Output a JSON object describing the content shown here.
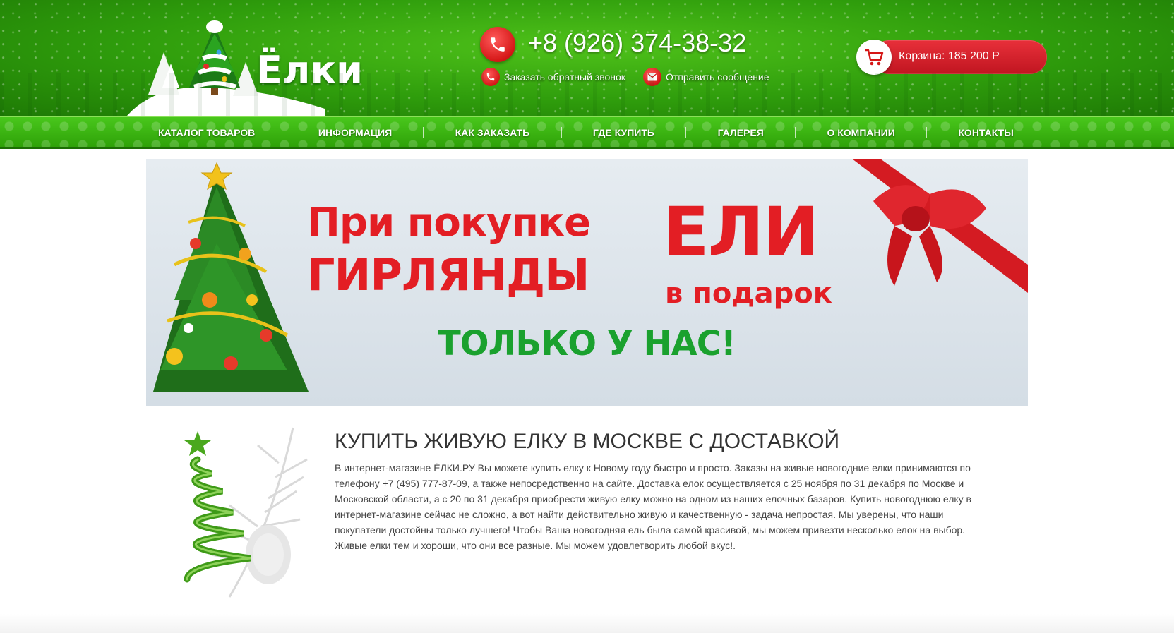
{
  "header": {
    "logo_text": "Ёлки",
    "phone": "+8 (926) 374-38-32",
    "callback_label": "Заказать обратный звонок",
    "message_label": "Отправить сообщение",
    "cart_label": "Корзина: 185 200 Р"
  },
  "nav": {
    "items": [
      "КАТАЛОГ ТОВАРОВ",
      "ИНФОРМАЦИЯ",
      "КАК ЗАКАЗАТЬ",
      "ГДЕ КУПИТЬ",
      "ГАЛЕРЕЯ",
      "О КОМПАНИИ",
      "КОНТАКТЫ"
    ]
  },
  "banner": {
    "line1": "При покупке",
    "line2": "ГИРЛЯНДЫ",
    "eli": "ЕЛИ",
    "gift": "в подарок",
    "only": "ТОЛЬКО У НАС!"
  },
  "content": {
    "title": "КУПИТЬ ЖИВУЮ ЕЛКУ В МОСКВЕ С ДОСТАВКОЙ",
    "text": "В интернет-магазине ЁЛКИ.РУ Вы можете купить елку к Новому году быстро и просто. Заказы на живые новогодние елки принимаются по телефону +7 (495) 777-87-09, а также непосредственно на сайте. Доставка елок осуществляется с 25 ноября по 31 декабря по Москве и Московской области, а с 20 по 31 декабря приобрести живую елку можно на одном из наших елочных базаров. Купить новогоднюю елку в интернет-магазине сейчас не сложно, а вот найти действительно живую и качественную - задача непростая. Мы уверены, что наши покупатели достойны только лучшего! Чтобы Ваша новогодняя ель была самой красивой, мы можем привезти несколько елок на выбор. Живые елки тем и хороши, что они все разные. Мы можем удовлетворить любой вкус!."
  },
  "icons": {
    "logo": "christmas-tree-logo-icon",
    "phone": "phone-icon",
    "callback": "phone-callback-icon",
    "message": "envelope-icon",
    "cart": "cart-icon",
    "bow": "gift-bow-icon",
    "decor": "christmas-tree-decor-icon"
  },
  "colors": {
    "header_green": "#2f9d0c",
    "accent_red": "#e31e24",
    "promo_green": "#1aa12e"
  }
}
